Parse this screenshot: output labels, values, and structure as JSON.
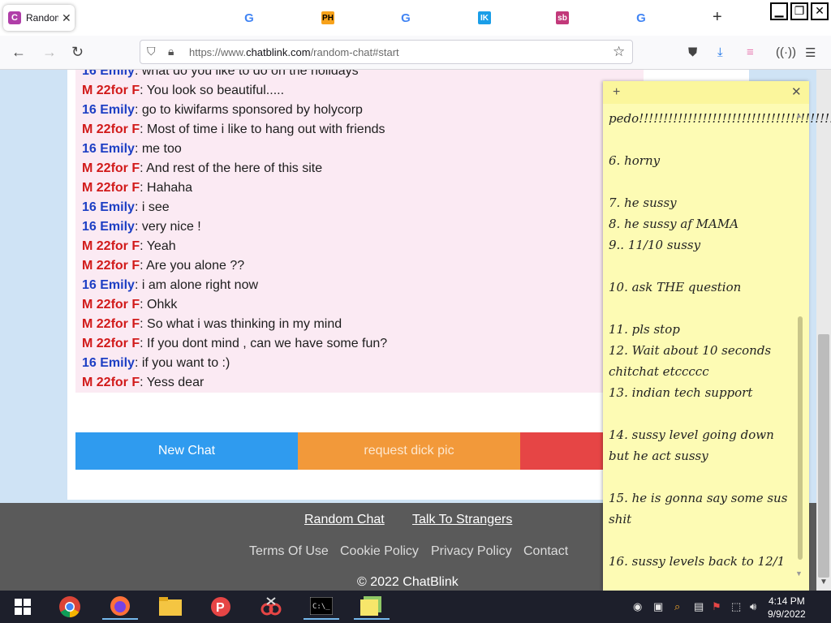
{
  "browser": {
    "active_tab": {
      "title": "Random",
      "favicon_letter": "C"
    },
    "tab_icons": [
      {
        "name": "google",
        "glyph": "G"
      },
      {
        "name": "ph",
        "glyph": "PH"
      },
      {
        "name": "google",
        "glyph": "G"
      },
      {
        "name": "ik",
        "glyph": "IK"
      },
      {
        "name": "sb",
        "glyph": "sb"
      },
      {
        "name": "google",
        "glyph": "G"
      }
    ],
    "url_prefix": "https://www.",
    "url_domain": "chatblink.com",
    "url_path": "/random-chat#start"
  },
  "chat": {
    "messages": [
      {
        "who": "16 Emily",
        "kind": "e",
        "text": ": what do you like to do on the holidays"
      },
      {
        "who": "M 22for F",
        "kind": "m",
        "text": ": You look so beautiful....."
      },
      {
        "who": "16 Emily",
        "kind": "e",
        "text": ": go to kiwifarms sponsored by holycorp"
      },
      {
        "who": "M 22for F",
        "kind": "m",
        "text": ": Most of time i like to hang out with friends"
      },
      {
        "who": "16 Emily",
        "kind": "e",
        "text": ": me too"
      },
      {
        "who": "M 22for F",
        "kind": "m",
        "text": ": And rest of the here of this site"
      },
      {
        "who": "M 22for F",
        "kind": "m",
        "text": ": Hahaha"
      },
      {
        "who": "16 Emily",
        "kind": "e",
        "text": ": i see"
      },
      {
        "who": "16 Emily",
        "kind": "e",
        "text": ": very nice !"
      },
      {
        "who": "M 22for F",
        "kind": "m",
        "text": ": Yeah"
      },
      {
        "who": "M 22for F",
        "kind": "m",
        "text": ": Are you alone ??"
      },
      {
        "who": "16 Emily",
        "kind": "e",
        "text": ": i am alone right now"
      },
      {
        "who": "M 22for F",
        "kind": "m",
        "text": ": Ohkk"
      },
      {
        "who": "M 22for F",
        "kind": "m",
        "text": ": So what i was thinking in my mind"
      },
      {
        "who": "M 22for F",
        "kind": "m",
        "text": ": If you dont mind , can we have some fun?"
      },
      {
        "who": "16 Emily",
        "kind": "e",
        "text": ": if you want to :)"
      },
      {
        "who": "M 22for F",
        "kind": "m",
        "text": ": Yess dear"
      }
    ],
    "buttons": {
      "new_chat": "New Chat",
      "request": "request dick pic"
    },
    "colors": {
      "new_chat": "#2f9bef",
      "request": "#f2993a",
      "third": "#e64545"
    }
  },
  "footer": {
    "link1": "Random Chat",
    "link2": "Talk To Strangers",
    "terms": "Terms Of Use",
    "cookie": "Cookie Policy",
    "privacy": "Privacy Policy",
    "contact": "Contact",
    "copyright": "© 2022 ChatBlink"
  },
  "sticky": {
    "lines": [
      "pedo!!!!!!!!!!!!!!!!!!!!!!!!!!!!!!!!!!!!!!!!!!!!",
      "",
      "6. horny",
      "",
      "7. he sussy",
      "8. he sussy af MAMA",
      "9.. 11/10 sussy",
      "",
      "10. ask THE question",
      "",
      "11. pls stop",
      "12. Wait about 10 seconds",
      "chitchat etccccc",
      "13. indian tech support",
      "",
      "14. sussy level going down",
      "but he act sussy",
      "",
      "15. he is gonna say some sus",
      "shit",
      "",
      "16. sussy levels back to 12/1"
    ]
  },
  "taskbar": {
    "time": "4:14 PM",
    "date": "9/9/2022"
  }
}
